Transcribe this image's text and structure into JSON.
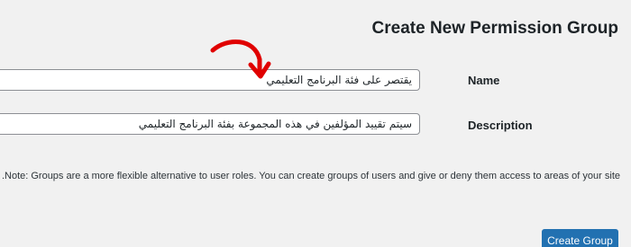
{
  "page": {
    "title": "Create New Permission Group"
  },
  "form": {
    "name_label": "Name",
    "name_value": "يقتصر على فئة البرنامج التعليمي",
    "description_label": "Description",
    "description_value": "سيتم تقييد المؤلفين في هذه المجموعة بفئة البرنامج التعليمي",
    "note": ".Note: Groups are a more flexible alternative to user roles. You can create groups of users and give or deny them access to areas of your site",
    "submit_label": "Create Group"
  },
  "annotation": {
    "arrow_color": "#e00000"
  },
  "colors": {
    "background": "#f1f1f1",
    "button": "#2271b1",
    "input_border": "#8c8f94"
  }
}
